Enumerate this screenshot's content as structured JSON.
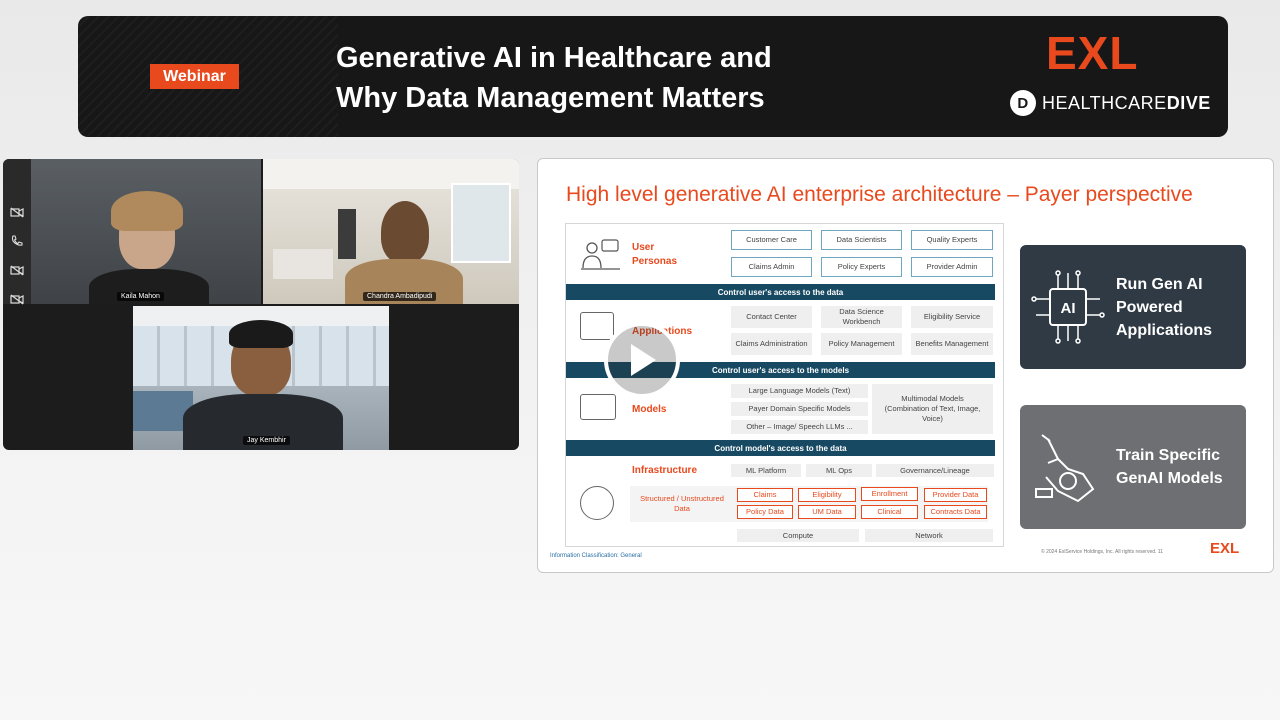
{
  "banner": {
    "badge": "Webinar",
    "title_line1": "Generative AI in Healthcare and",
    "title_line2": "Why Data Management Matters",
    "brand_exl": "EXL",
    "brand_hd_prefix": "HEALTHCARE",
    "brand_hd_suffix": "DIVE"
  },
  "video": {
    "participants": [
      {
        "name": "Kaila Mahon"
      },
      {
        "name": "Chandra Ambadipudi"
      },
      {
        "name": "Jay Kembhir"
      }
    ],
    "sidebar_icons": [
      "camera-off-icon",
      "phone-icon",
      "camera-off-icon",
      "camera-off-icon"
    ]
  },
  "slide": {
    "title": "High level generative AI enterprise architecture – Payer perspective",
    "user_personas": {
      "label_line1": "User",
      "label_line2": "Personas",
      "items": [
        "Customer Care",
        "Data Scientists",
        "Quality Experts",
        "Claims Admin",
        "Policy Experts",
        "Provider Admin"
      ]
    },
    "band1": "Control user's access to the data",
    "applications": {
      "label": "Applications",
      "items": [
        "Contact Center",
        "Data Science Workbench",
        "Eligibility Service",
        "Claims Administration",
        "Policy Management",
        "Benefits Management"
      ]
    },
    "band2": "Control user's access to the models",
    "models": {
      "label": "Models",
      "items": [
        "Large Language Models (Text)",
        "Payer Domain Specific Models",
        "Other – Image/ Speech LLMs ..."
      ],
      "multimodal": "Multimodal Models (Combination of Text, Image, Voice)"
    },
    "band3": "Control model's access to the data",
    "infrastructure": {
      "label": "Infrastructure",
      "items": [
        "ML Platform",
        "ML Ops",
        "Governance/Lineage"
      ],
      "data_label": "Structured / Unstructured Data",
      "data_items": [
        "Claims",
        "Eligibility",
        "Enrollment",
        "Provider Data",
        "Policy Data",
        "UM Data",
        "Clinical",
        "Contracts Data"
      ],
      "bottom": [
        "Compute",
        "Network"
      ]
    },
    "card1": "Run Gen AI Powered Applications",
    "card2": "Train Specific GenAI Models",
    "footer_left": "Information Classification: General",
    "footer_right": "© 2024 ExlService Holdings, Inc. All rights reserved.   11",
    "brand": "EXL",
    "ai_chip": "AI"
  },
  "colors": {
    "accent": "#e8491d",
    "band": "#174a62",
    "card1": "#2f3a45",
    "card2": "#6d6f72"
  }
}
